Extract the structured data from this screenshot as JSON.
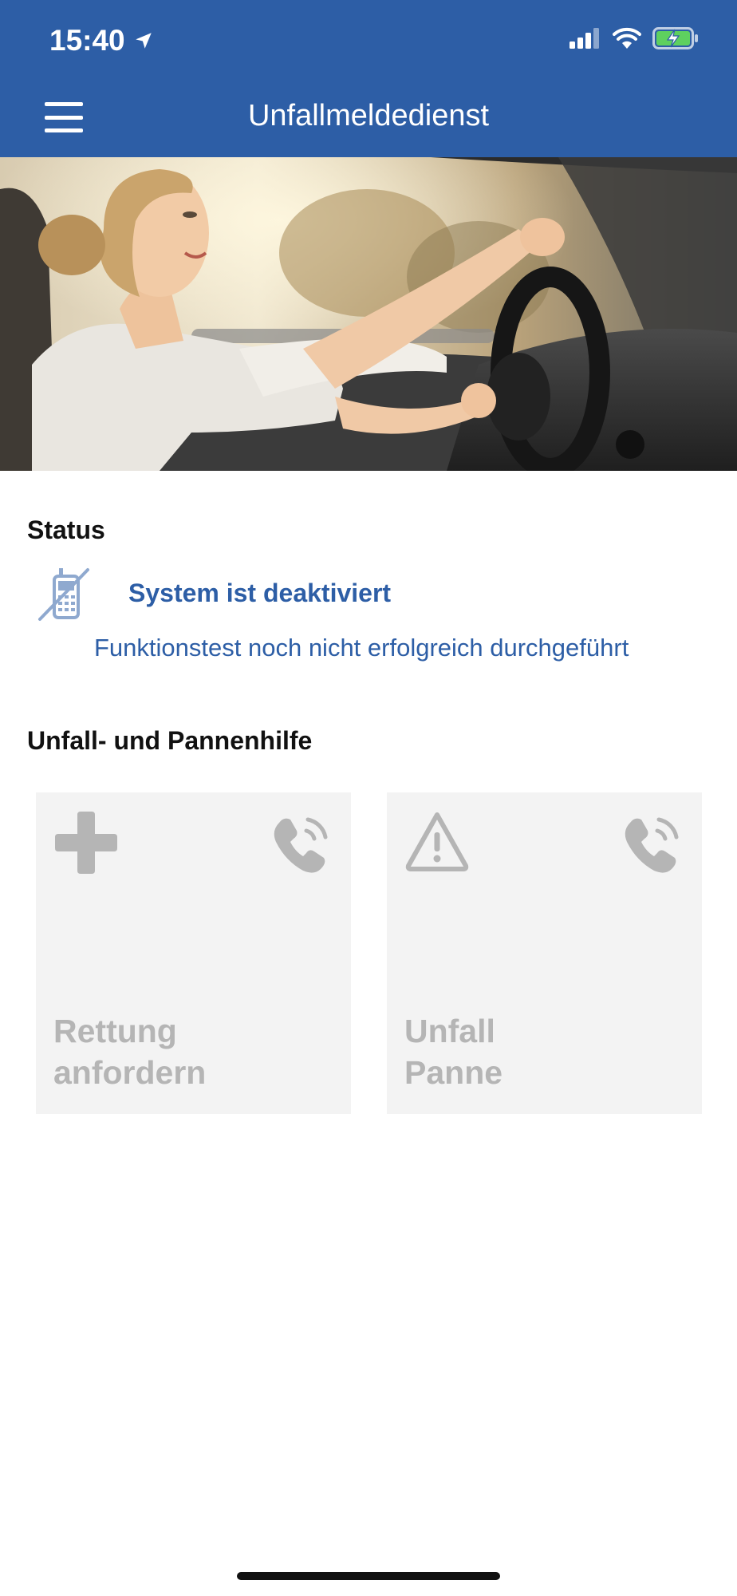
{
  "status_bar": {
    "time": "15:40"
  },
  "header": {
    "title": "Unfallmeldedienst"
  },
  "status": {
    "section_title": "Status",
    "headline": "System ist deaktiviert",
    "detail": "Funktionstest noch nicht erfolgreich durchgeführt"
  },
  "help": {
    "section_title": "Unfall- und Pannenhilfe",
    "cards": [
      {
        "line1": "Rettung",
        "line2": "anfordern",
        "icon": "medical-cross-icon",
        "call_icon": "phone-call-icon"
      },
      {
        "line1": "Unfall",
        "line2": "Panne",
        "icon": "warning-triangle-icon",
        "call_icon": "phone-call-icon"
      }
    ]
  },
  "colors": {
    "brand_blue": "#2d5ea6",
    "card_bg": "#f3f3f3",
    "card_text": "#b5b5b5"
  }
}
